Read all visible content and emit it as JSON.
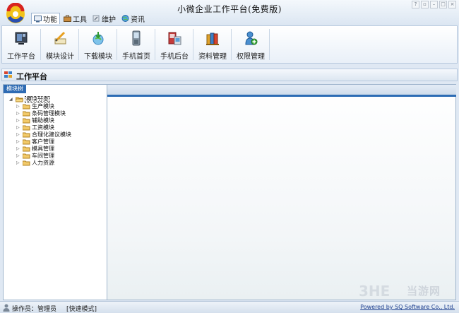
{
  "window": {
    "title": "小微企业工作平台(免费版)",
    "controls": [
      "?",
      "▫",
      "–",
      "□",
      "×"
    ]
  },
  "menu": {
    "tabs": [
      {
        "label": "功能",
        "icon": "monitor-icon",
        "active": true
      },
      {
        "label": "工具",
        "icon": "toolbox-icon",
        "active": false
      },
      {
        "label": "维护",
        "icon": "wrench-icon",
        "active": false
      },
      {
        "label": "资讯",
        "icon": "globe-icon",
        "active": false
      }
    ]
  },
  "ribbon": {
    "buttons": [
      {
        "label": "工作平台",
        "icon": "workbench-icon"
      },
      {
        "label": "模块设计",
        "icon": "design-pen-icon"
      },
      {
        "label": "下载模块",
        "icon": "download-icon"
      },
      {
        "label": "手机首页",
        "icon": "phone-icon"
      },
      {
        "label": "手机后台",
        "icon": "phone-admin-icon"
      },
      {
        "label": "资料管理",
        "icon": "books-icon"
      },
      {
        "label": "权限管理",
        "icon": "permission-user-icon"
      }
    ]
  },
  "section": {
    "title": "工作平台"
  },
  "tree": {
    "tab_label": "模块树",
    "root": {
      "label": "模块分类",
      "expanded": true
    },
    "items": [
      "生产模块",
      "条码管理模块",
      "辅助模块",
      "工资模块",
      "合理化建议模块",
      "客户管理",
      "模具管理",
      "车间管理",
      "人力资源"
    ]
  },
  "status": {
    "operator": "操作员：管理员",
    "mode": "[快速模式]",
    "powered_by": "Powered by SQ Software Co., Ltd."
  },
  "watermark": {
    "brand": "3HE",
    "text": "当游网"
  },
  "colors": {
    "accent": "#2d6cb4",
    "tree_tab": "#2e6bb3",
    "link": "#1d3f8f"
  }
}
